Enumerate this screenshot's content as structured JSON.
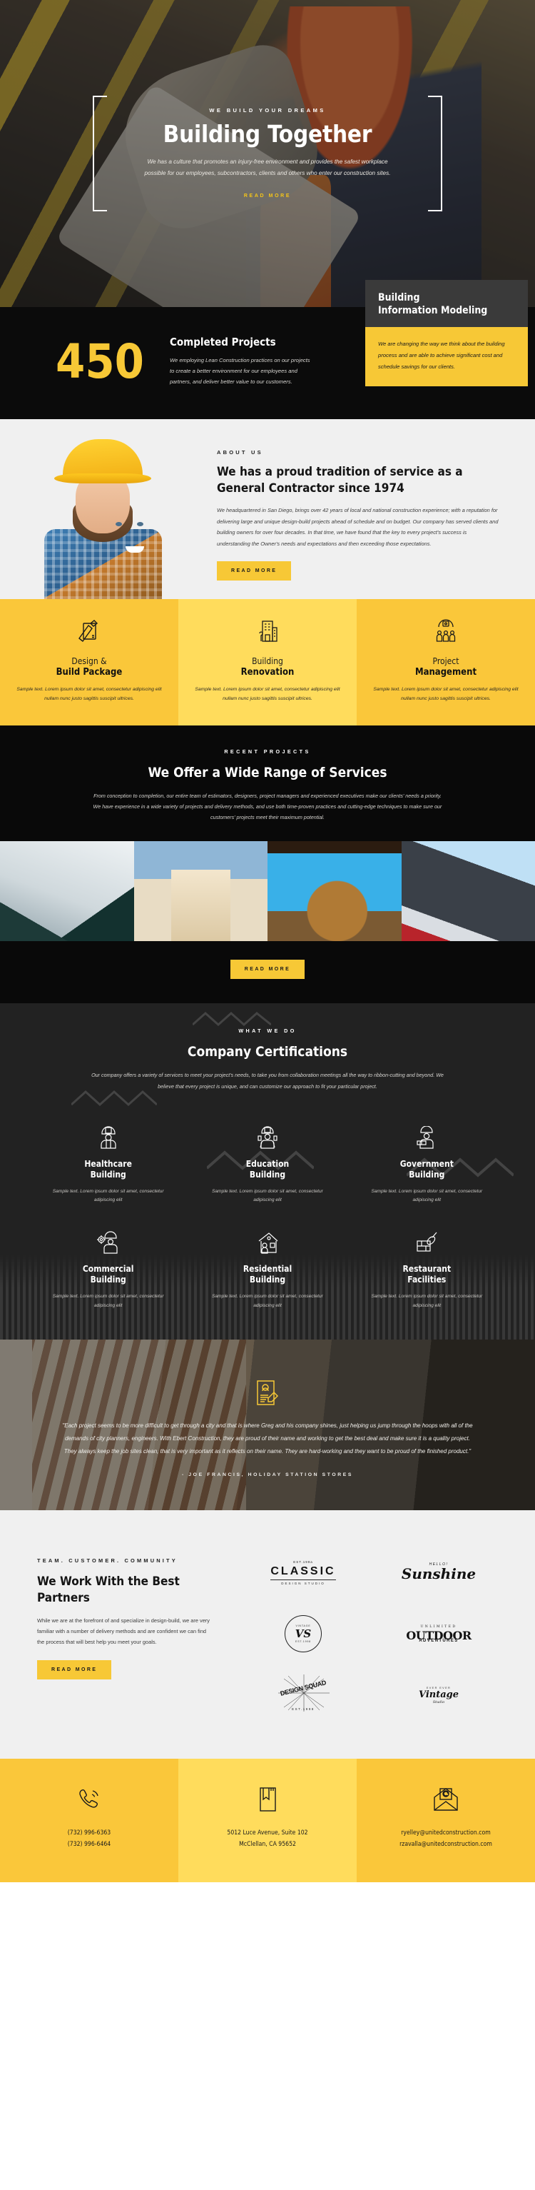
{
  "hero": {
    "eyebrow": "WE BUILD YOUR DREAMS",
    "title": "Building Together",
    "subtitle": "We has a culture that promotes an injury-free environment and provides the safest workplace possible for our employees, subcontractors, clients and others who enter our construction sites.",
    "cta": "READ MORE"
  },
  "stats": {
    "number": "450",
    "title": "Completed Projects",
    "description": "We employing Lean Construction practices on our projects to create a better environment for our employees and partners, and deliver better value to our customers."
  },
  "bim": {
    "title": "Building\nInformation Modeling",
    "title_line1": "Building",
    "title_line2": "Information Modeling",
    "description": "We are changing the way we think about the building process and are able to achieve significant cost and schedule savings for our clients."
  },
  "about": {
    "eyebrow": "ABOUT US",
    "title": "We has a proud tradition of service as a General Contractor since 1974",
    "body": "We headquartered in San Diego, brings over 42 years of local and national construction experience; with a reputation for delivering large and unique design-build projects ahead of schedule and on budget.  Our company has served clients and building owners for over four decades. In that time, we have found that the key to every project's success is understanding the Owner's needs and expectations and then exceeding those expectations.",
    "cta": "READ MORE"
  },
  "services": [
    {
      "icon": "design-ruler-pencil-icon",
      "line1": "Design &",
      "line2": "Build Package",
      "description": "Sample text. Lorem ipsum dolor sit amet, consectetur adipiscing elit nullam nunc justo sagittis suscipit ultrices."
    },
    {
      "icon": "office-building-icon",
      "line1": "Building",
      "line2": "Renovation",
      "description": "Sample text. Lorem ipsum dolor sit amet, consectetur adipiscing elit nullam nunc justo sagittis suscipit ultrices."
    },
    {
      "icon": "team-management-icon",
      "line1": "Project",
      "line2": "Management",
      "description": "Sample text. Lorem ipsum dolor sit amet, consectetur adipiscing elit nullam nunc justo sagittis suscipit ultrices."
    }
  ],
  "projects": {
    "eyebrow": "RECENT PROJECTS",
    "title": "We Offer a Wide Range of Services",
    "description": "From conception to completion, our entire team of estimators, designers, project managers and experienced executives make our clients' needs a priority. We have experience in a wide variety of projects and delivery methods, and use both time-proven practices and cutting-edge techniques to make sure our customers' projects meet their maximum potential.",
    "cta": "READ MORE",
    "gallery": [
      "skyscrapers-upward-view",
      "house-gable-blue-sky",
      "curved-timber-facade",
      "modern-dark-panel-building"
    ]
  },
  "certifications": {
    "eyebrow": "WHAT WE DO",
    "title": "Company Certifications",
    "description": "Our company offers a variety of services to meet your project's needs, to take you from collaboration meetings all the way to ribbon-cutting and beyond. We believe that every project is unique, and can customize our approach to fit your particular project.",
    "items": [
      {
        "icon": "worker-helmet-icon",
        "line1": "Healthcare",
        "line2": "Building",
        "description": "Sample text. Lorem ipsum dolor sit amet, consectetur adipiscing elit"
      },
      {
        "icon": "painter-worker-icon",
        "line1": "Education",
        "line2": "Building",
        "description": "Sample text. Lorem ipsum dolor sit amet, consectetur adipiscing elit"
      },
      {
        "icon": "bricklayer-icon",
        "line1": "Government",
        "line2": "Building",
        "description": "Sample text. Lorem ipsum dolor sit amet, consectetur adipiscing elit"
      },
      {
        "icon": "engineer-gear-icon",
        "line1": "Commercial",
        "line2": "Building",
        "description": "Sample text. Lorem ipsum dolor sit amet, consectetur adipiscing elit"
      },
      {
        "icon": "house-worker-icon",
        "line1": "Residential",
        "line2": "Building",
        "description": "Sample text. Lorem ipsum dolor sit amet, consectetur adipiscing elit"
      },
      {
        "icon": "trowel-brick-icon",
        "line1": "Restaurant",
        "line2": "Facilities",
        "description": "Sample text. Lorem ipsum dolor sit amet, consectetur adipiscing elit"
      }
    ]
  },
  "testimonial": {
    "icon": "document-signature-icon",
    "quote": "\"Each project seems to be more difficult to get through a city and that is where Greg and his company shines, just helping us jump through the hoops with all of the demands of city planners, engineers. With Ebert Construction, they are proud of their name and working to get the best deal and make sure it is a quality project. They always keep the job sites clean, that is very important as it reflects on their name. They are hard-working and they want to be proud of the finished product.\"",
    "author": "- JOE FRANCIS, HOLIDAY STATION STORES"
  },
  "partners": {
    "eyebrow": "TEAM. CUSTOMER. COMMUNITY",
    "title": "We Work With the Best Partners",
    "body": "While we are at the forefront of and specialize in design-build, we are very familiar with a number of delivery methods and are confident we can find the process that will best help you meet your goals.",
    "cta": "READ MORE",
    "logos": [
      {
        "name": "classic-design-studio-logo",
        "top": "EST.199a",
        "main": "CLASSIC",
        "bottom": "DESIGN STUDIO"
      },
      {
        "name": "hello-sunshine-logo",
        "top": "HELLO!",
        "main": "Sunshine",
        "bottom": ""
      },
      {
        "name": "vs-monogram-logo",
        "top": "VINTAGE",
        "main": "VS",
        "bottom": "EST.1998"
      },
      {
        "name": "unlimited-outdoor-adventures-logo",
        "top": "UNLIMITED",
        "main": "OUTDOOR",
        "bottom": "ADVENTURES"
      },
      {
        "name": "design-squad-burst-logo",
        "top": "",
        "main": "DESIGN SQUAD",
        "bottom": "EST.1998"
      },
      {
        "name": "vintage-studio-logo",
        "top": "EVER EVER",
        "main": "Vintage",
        "bottom": "Studio"
      }
    ]
  },
  "footer": {
    "columns": [
      {
        "icon": "phone-icon",
        "lines": [
          "(732) 996-6363",
          "(732) 996-6464"
        ]
      },
      {
        "icon": "address-book-icon",
        "lines": [
          "5012 Luce Avenue, Suite 102",
          "McClellan, CA 95652"
        ]
      },
      {
        "icon": "email-envelope-icon",
        "lines": [
          "ryelley@unitedconstruction.com",
          "rzavalla@unitedconstruction.com"
        ]
      }
    ]
  },
  "colors": {
    "accent_yellow": "#f7c836",
    "accent_yellow_light": "#ffdc5c",
    "dark": "#0b0b0b",
    "dark_gray": "#222222",
    "light_gray": "#f0f0f0"
  }
}
